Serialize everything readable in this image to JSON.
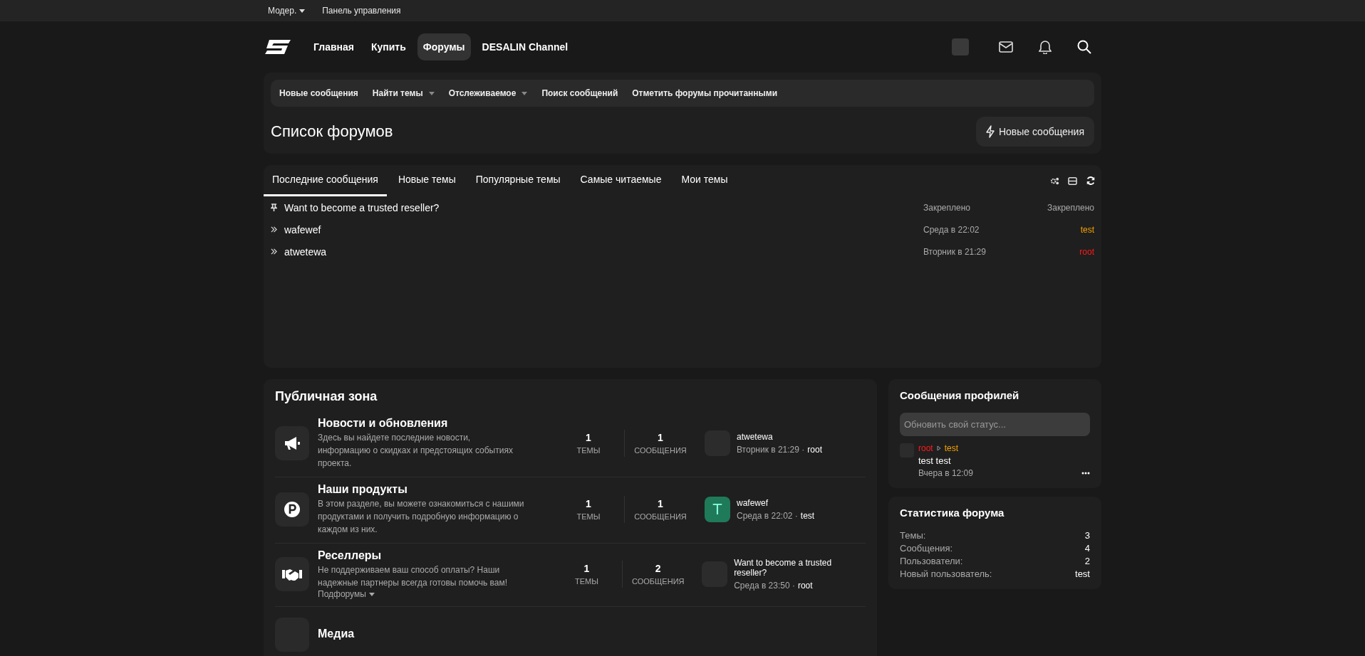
{
  "top_bar": {
    "items": [
      {
        "label": "Модер.",
        "dropdown": true
      },
      {
        "label": "Панель управления",
        "dropdown": false
      }
    ]
  },
  "nav": {
    "items": [
      {
        "label": "Главная",
        "selected": false
      },
      {
        "label": "Купить",
        "selected": false
      },
      {
        "label": "Форумы",
        "selected": true
      },
      {
        "label": "DESALIN Channel",
        "selected": false
      }
    ]
  },
  "sub_nav": {
    "items": [
      {
        "label": "Новые сообщения",
        "dropdown": false
      },
      {
        "label": "Найти темы",
        "dropdown": true
      },
      {
        "label": "Отслеживаемое",
        "dropdown": true
      },
      {
        "label": "Поиск сообщений",
        "dropdown": false
      },
      {
        "label": "Отметить форумы прочитанными",
        "dropdown": false
      }
    ]
  },
  "page_title": "Список форумов",
  "new_posts_button": "Новые сообщения",
  "latest": {
    "tabs": [
      {
        "label": "Последние сообщения",
        "selected": true
      },
      {
        "label": "Новые темы",
        "selected": false
      },
      {
        "label": "Популярные темы",
        "selected": false
      },
      {
        "label": "Самые читаемые",
        "selected": false
      },
      {
        "label": "Мои темы",
        "selected": false
      }
    ],
    "threads": [
      {
        "kind": "pinned",
        "title": "Want to become a trusted reseller?",
        "date": "Закреплено",
        "user": "Закреплено",
        "color": "#a9a9a9"
      },
      {
        "kind": "normal",
        "title": "wafewef",
        "date": "Среда в 22:02",
        "user": "test",
        "color": "#f5a200"
      },
      {
        "kind": "normal",
        "title": "atwetewa",
        "date": "Вторник в 21:29",
        "user": "root",
        "color": "#ff1a1a"
      }
    ]
  },
  "category": {
    "title": "Публичная зона",
    "forums": [
      {
        "kind": "megaphone",
        "title": "Новости и обновления",
        "description": "Здесь вы найдете последние новости, информацию о скидках и предстоящих событиях проекта.",
        "threads": "1",
        "threads_label": "ТЕМЫ",
        "messages": "1",
        "messages_label": "СООБЩЕНИЯ",
        "last": {
          "kind": "photo",
          "title": "atwetewa",
          "date": "Вторник в 21:29 ·",
          "user": "root"
        }
      },
      {
        "kind": "coin",
        "title": "Наши продукты",
        "description": "В этом разделе, вы можете ознакомиться с нашими продуктами и получить подробную информацию о каждом из них.",
        "threads": "1",
        "threads_label": "ТЕМЫ",
        "messages": "1",
        "messages_label": "СООБЩЕНИЯ",
        "last": {
          "kind": "letter",
          "letter": "T",
          "color": "#1f7a5a",
          "title": "wafewef",
          "date": "Среда в 22:02 ·",
          "user": "test"
        }
      },
      {
        "kind": "handshake",
        "title": "Реселлеры",
        "description": "Не поддерживаем ваш способ оплаты? Наши надежные партнеры всегда готовы помочь вам!",
        "subforums": "Подфорумы",
        "threads": "1",
        "threads_label": "ТЕМЫ",
        "messages": "2",
        "messages_label": "СООБЩЕНИЯ",
        "last": {
          "kind": "photo",
          "title": "Want to become a trusted reseller?",
          "date": "Среда в 23:50 ·",
          "user": "root"
        }
      },
      {
        "kind": "media",
        "title": "Медиа"
      }
    ]
  },
  "profile_posts": {
    "title": "Сообщения профилей",
    "placeholder": "Обновить свой статус...",
    "posts": [
      {
        "author": {
          "name": "root",
          "color": "#ff1a1a"
        },
        "target": {
          "name": "test",
          "color": "#f5a200"
        },
        "text": "test test",
        "date": "Вчера в 12:09"
      }
    ]
  },
  "stats": {
    "title": "Статистика форума",
    "rows": [
      {
        "label": "Темы:",
        "value": "3"
      },
      {
        "label": "Сообщения:",
        "value": "4"
      },
      {
        "label": "Пользователи:",
        "value": "2"
      },
      {
        "label": "Новый пользователь:",
        "value": "test"
      }
    ]
  }
}
